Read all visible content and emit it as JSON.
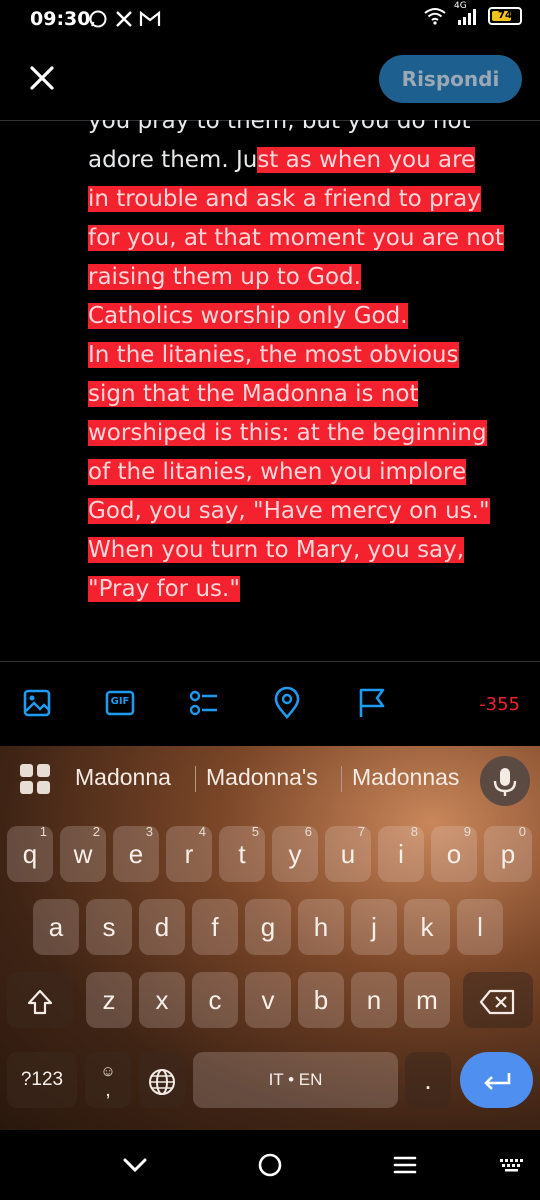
{
  "status_bar": {
    "time": "09:30",
    "notif_icons": [
      "whatsapp-icon",
      "x-icon",
      "gmail-icon"
    ],
    "network": "4G",
    "battery": "74",
    "battery_level": 0.74
  },
  "header": {
    "reply_label": "Rispondi"
  },
  "tweet": {
    "line0": "you pray to them, but you do not",
    "line1_plain": "adore them. Ju",
    "line1_over": "st as when you are",
    "line2": "in trouble and ask a friend to pray",
    "line3": "for you, at that moment you are not",
    "line4": "raising them up to God.",
    "line5": "Catholics worship only God.",
    "line6": "In the litanies, the most obvious",
    "line7": "sign that the Madonna is not",
    "line8": "worshiped is this: at the beginning",
    "line9": "of the litanies, when you implore",
    "line10": "God, you say, \"Have mercy on us.\"",
    "line11": "When you turn to Mary, you say,",
    "line12": "\"Pray for us.\""
  },
  "toolbar": {
    "icons": [
      "image-icon",
      "gif-icon",
      "poll-icon",
      "location-icon",
      "flag-icon"
    ],
    "gif_label": "GIF",
    "char_counter": "-355"
  },
  "keyboard": {
    "suggestions": [
      "Madonna",
      "Madonna's",
      "Madonnas"
    ],
    "row1": [
      "q",
      "w",
      "e",
      "r",
      "t",
      "y",
      "u",
      "i",
      "o",
      "p"
    ],
    "row1_nums": [
      "1",
      "2",
      "3",
      "4",
      "5",
      "6",
      "7",
      "8",
      "9",
      "0"
    ],
    "row2": [
      "a",
      "s",
      "d",
      "f",
      "g",
      "h",
      "j",
      "k",
      "l"
    ],
    "row3": [
      "z",
      "x",
      "c",
      "v",
      "b",
      "n",
      "m"
    ],
    "sym_label": "?123",
    "emoji_comma": ",",
    "space_label": "IT • EN",
    "period_label": "."
  },
  "colors": {
    "accent": "#1d9bf0",
    "over_limit": "#f4212e",
    "enter_key": "#4f8ff0"
  }
}
